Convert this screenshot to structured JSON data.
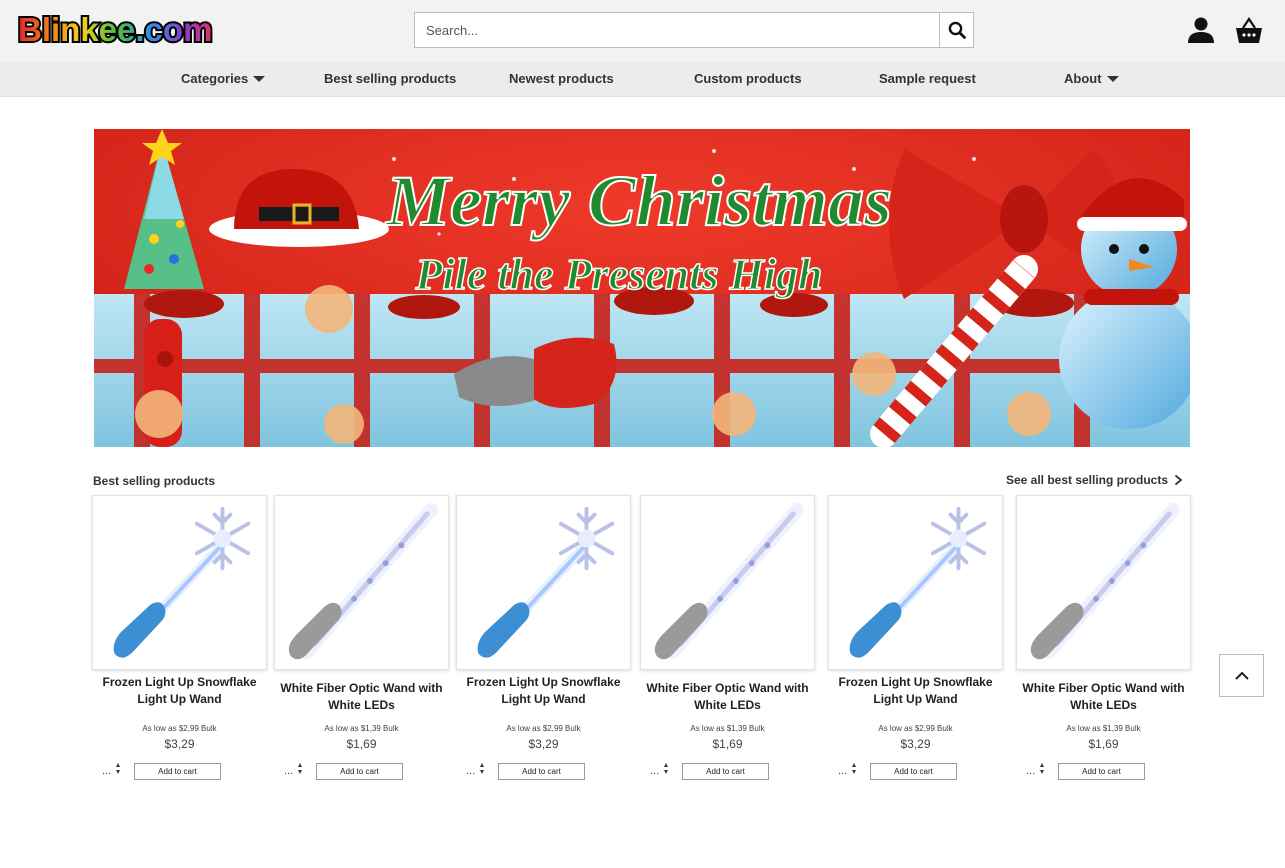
{
  "header": {
    "logo_text": "Blinkee.com",
    "search": {
      "placeholder": "Search...",
      "value": ""
    },
    "icons": [
      "search-icon",
      "account-icon",
      "basket-icon"
    ]
  },
  "nav": {
    "items": [
      {
        "label": "Categories",
        "has_caret": true
      },
      {
        "label": "Best selling products",
        "has_caret": false
      },
      {
        "label": "Newest products",
        "has_caret": false
      },
      {
        "label": "Custom products",
        "has_caret": false
      },
      {
        "label": "Sample request",
        "has_caret": false
      },
      {
        "label": "About",
        "has_caret": true
      }
    ]
  },
  "banner": {
    "headline": "Merry Christmas",
    "subheadline": "Pile the Presents High",
    "colors": {
      "background": "#d8261c",
      "headline": "#1f8a2f"
    }
  },
  "best_selling": {
    "title": "Best selling products",
    "see_all_label": "See all best selling products",
    "products": [
      {
        "name": "Frozen Light Up Snowflake Light Up Wand",
        "bulk": "As low as $2,99 Bulk",
        "price": "$3,29",
        "qty": "...",
        "cart_label": "Add to cart",
        "image": "snowflake-wand"
      },
      {
        "name": "White Fiber Optic Wand with White LEDs",
        "bulk": "As low as $1,39 Bulk",
        "price": "$1,69",
        "qty": "...",
        "cart_label": "Add to cart",
        "image": "fiber-wand"
      },
      {
        "name": "Frozen Light Up Snowflake Light Up Wand",
        "bulk": "As low as $2,99 Bulk",
        "price": "$3,29",
        "qty": "...",
        "cart_label": "Add to cart",
        "image": "snowflake-wand"
      },
      {
        "name": "White Fiber Optic Wand with White LEDs",
        "bulk": "As low as $1,39 Bulk",
        "price": "$1,69",
        "qty": "...",
        "cart_label": "Add to cart",
        "image": "fiber-wand"
      },
      {
        "name": "Frozen Light Up Snowflake Light Up Wand",
        "bulk": "As low as $2,99 Bulk",
        "price": "$3,29",
        "qty": "...",
        "cart_label": "Add to cart",
        "image": "snowflake-wand"
      },
      {
        "name": "White Fiber Optic Wand with White LEDs",
        "bulk": "As low as $1,39 Bulk",
        "price": "$1,69",
        "qty": "...",
        "cart_label": "Add to cart",
        "image": "fiber-wand"
      }
    ]
  },
  "colors": {
    "topbar": "#f2f2f2",
    "navbar": "#ececec",
    "wand_handle": "#3d8fd4",
    "fiber_handle": "#9a9a9a"
  }
}
